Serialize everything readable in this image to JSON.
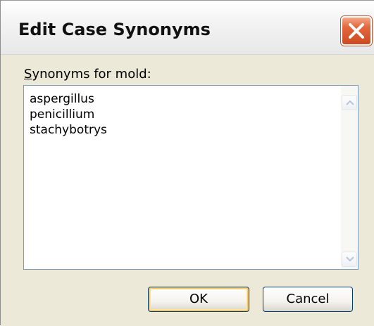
{
  "window": {
    "title": "Edit Case Synonyms",
    "close_icon": "close-icon",
    "accent_color": "#d85a32"
  },
  "form": {
    "label_mnemonic": "S",
    "label_rest": "ynonyms for mold:",
    "synonyms": [
      "aspergillus",
      "penicillium",
      "stachybotrys"
    ]
  },
  "scrollbar": {
    "up_icon": "scroll-up-arrow-icon",
    "down_icon": "scroll-down-arrow-icon"
  },
  "buttons": {
    "ok_label": "OK",
    "cancel_label": "Cancel"
  }
}
